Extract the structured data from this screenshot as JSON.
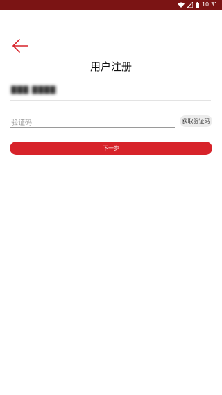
{
  "status_bar": {
    "time": "10:31",
    "icons": [
      "wifi-icon",
      "signal-icon",
      "battery-icon"
    ]
  },
  "colors": {
    "status_bar": "#7b1414",
    "accent": "#d7232a",
    "back_arrow": "#d7232a"
  },
  "header": {
    "back_icon": "arrow-left-icon",
    "title": "用户注册"
  },
  "form": {
    "phone_value": "███ ████",
    "code_placeholder": "验证码",
    "code_value": "",
    "get_code_label": "获取验证码",
    "next_label": "下一步"
  }
}
